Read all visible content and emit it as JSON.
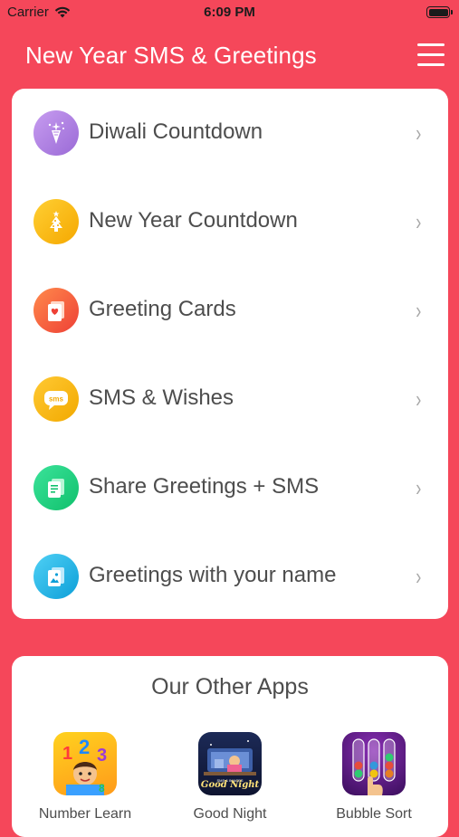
{
  "status_bar": {
    "carrier": "Carrier",
    "time": "6:09 PM",
    "battery_level": 1.0
  },
  "nav": {
    "title": "New Year SMS & Greetings"
  },
  "menu": {
    "items": [
      {
        "label": "Diwali Countdown",
        "icon": "sparkle-cone-icon",
        "color": "#b07ee0"
      },
      {
        "label": "New Year Countdown",
        "icon": "christmas-tree-icon",
        "color": "#f7b500"
      },
      {
        "label": "Greeting Cards",
        "icon": "greeting-card-icon",
        "color": "#f25d3a"
      },
      {
        "label": "SMS & Wishes",
        "icon": "sms-bubble-icon",
        "color": "#f6b400"
      },
      {
        "label": "Share Greetings + SMS",
        "icon": "share-cards-icon",
        "color": "#1ccf80"
      },
      {
        "label": "Greetings with your name",
        "icon": "photo-card-icon",
        "color": "#1fb7e8"
      }
    ],
    "chevron": "›"
  },
  "other_apps": {
    "title": "Our Other Apps",
    "apps": [
      {
        "name": "Number Learn",
        "icon": "numbers-app-icon"
      },
      {
        "name": "Good Night",
        "icon": "good-night-app-icon"
      },
      {
        "name": "Bubble Sort",
        "icon": "bubble-sort-app-icon"
      }
    ],
    "good_night_logo_text": "Good Night"
  },
  "colors": {
    "background": "#f5475a",
    "card": "#ffffff"
  }
}
